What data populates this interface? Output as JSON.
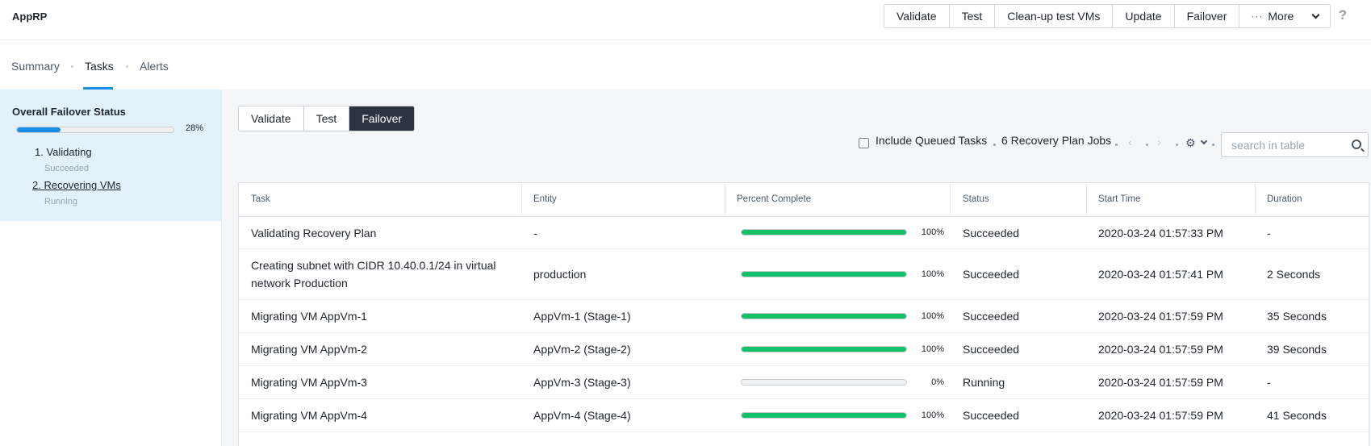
{
  "header": {
    "title": "AppRP",
    "actions": [
      "Validate",
      "Test",
      "Clean-up test VMs",
      "Update",
      "Failover"
    ],
    "more_label": "More",
    "help_label": "?"
  },
  "tabs": [
    {
      "label": "Summary",
      "active": false
    },
    {
      "label": "Tasks",
      "active": true
    },
    {
      "label": "Alerts",
      "active": false
    }
  ],
  "status_panel": {
    "title": "Overall Failover Status",
    "progress": 0.28,
    "percent_label": "28%",
    "steps": [
      {
        "label": "1. Validating",
        "sub": "Succeeded"
      },
      {
        "label": "2. Recovering VMs",
        "sub": "Running"
      }
    ]
  },
  "mode_filter": {
    "options": [
      "Validate",
      "Test",
      "Failover"
    ],
    "selected": "Failover"
  },
  "toolbar": {
    "include_queued_label": "Include Queued Tasks",
    "include_queued_checked": false,
    "jobs_count_label": "6 Recovery Plan Jobs",
    "search_placeholder": "search in table"
  },
  "table": {
    "columns": [
      "Task",
      "Entity",
      "Percent Complete",
      "Status",
      "Start Time",
      "Duration"
    ],
    "rows": [
      {
        "task": "Validating Recovery Plan",
        "entity": "-",
        "percent": 100,
        "percent_label": "100%",
        "status": "Succeeded",
        "start": "2020-03-24 01:57:33 PM",
        "duration": "-"
      },
      {
        "task": "Creating subnet with CIDR 10.40.0.1/24 in virtual network Production",
        "entity": "production",
        "percent": 100,
        "percent_label": "100%",
        "status": "Succeeded",
        "start": "2020-03-24 01:57:41 PM",
        "duration": "2 Seconds"
      },
      {
        "task": "Migrating VM AppVm-1",
        "entity": "AppVm-1 (Stage-1)",
        "percent": 100,
        "percent_label": "100%",
        "status": "Succeeded",
        "start": "2020-03-24 01:57:59 PM",
        "duration": "35 Seconds"
      },
      {
        "task": "Migrating VM AppVm-2",
        "entity": "AppVm-2 (Stage-2)",
        "percent": 100,
        "percent_label": "100%",
        "status": "Succeeded",
        "start": "2020-03-24 01:57:59 PM",
        "duration": "39 Seconds"
      },
      {
        "task": "Migrating VM AppVm-3",
        "entity": "AppVm-3 (Stage-3)",
        "percent": 0,
        "percent_label": "0%",
        "status": "Running",
        "start": "2020-03-24 01:57:59 PM",
        "duration": "-"
      },
      {
        "task": "Migrating VM AppVm-4",
        "entity": "AppVm-4 (Stage-4)",
        "percent": 100,
        "percent_label": "100%",
        "status": "Succeeded",
        "start": "2020-03-24 01:57:59 PM",
        "duration": "41 Seconds"
      }
    ]
  },
  "colors": {
    "accent": "#1b8fe8",
    "progress_green": "#11c16a",
    "panel_bg": "#e3f1fb",
    "active_segment": "#2b3440"
  }
}
